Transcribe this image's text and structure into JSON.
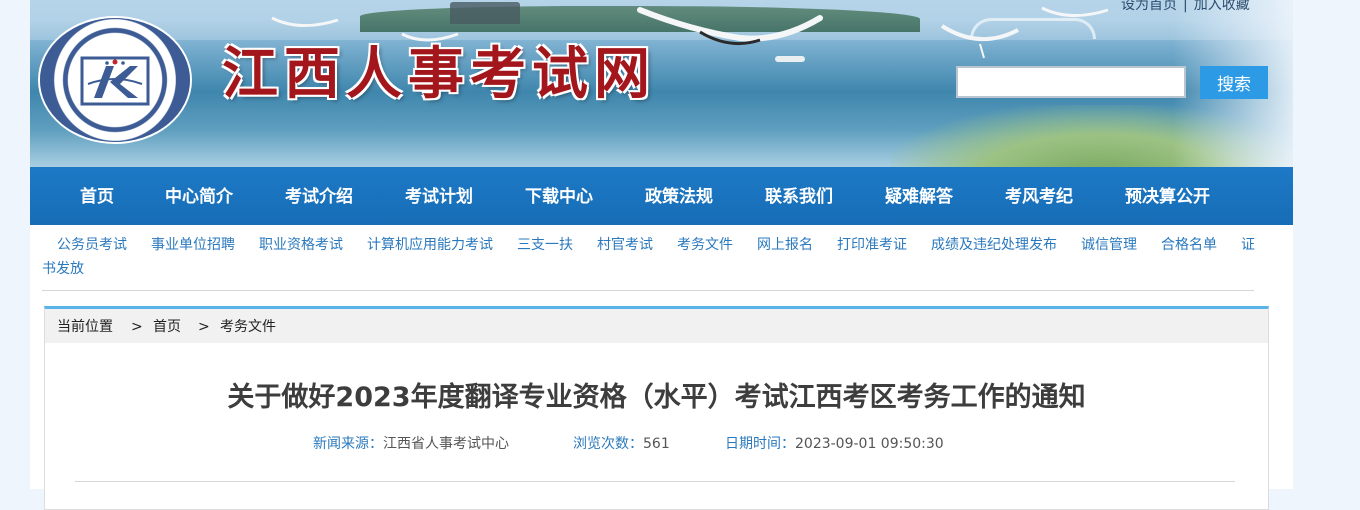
{
  "header": {
    "site_title": "江西人事考试网",
    "top_links": [
      "设为首页",
      "加入收藏"
    ],
    "top_links_separator": "|",
    "search": {
      "placeholder": "",
      "button_label": "搜索"
    },
    "logo_icon": "jiangxi-personnel-exam-center-logo-icon"
  },
  "nav": {
    "items": [
      "首页",
      "中心简介",
      "考试介绍",
      "考试计划",
      "下载中心",
      "政策法规",
      "联系我们",
      "疑难解答",
      "考风考纪",
      "预决算公开"
    ]
  },
  "sublinks": [
    "公务员考试",
    "事业单位招聘",
    "职业资格考试",
    "计算机应用能力考试",
    "三支一扶",
    "村官考试",
    "考务文件",
    "网上报名",
    "打印准考证",
    "成绩及违纪处理发布",
    "诚信管理",
    "合格名单",
    "证书发放"
  ],
  "breadcrumb": {
    "label": "当前位置",
    "separator": ">",
    "items": [
      "首页",
      "考务文件"
    ]
  },
  "article": {
    "title": "关于做好2023年度翻译专业资格（水平）考试江西考区考务工作的通知",
    "source_label": "新闻来源：",
    "source_value": "江西省人事考试中心",
    "views_label": "浏览次数：",
    "views_value": "561",
    "date_label": "日期时间：",
    "date_value": "2023-09-01 09:50:30"
  },
  "colors": {
    "nav_bg": "#1d79c6",
    "title_red": "#a3171c",
    "link_blue": "#2b79bd",
    "accent_line": "#5ab4ea",
    "search_button": "#2d9ae6"
  }
}
